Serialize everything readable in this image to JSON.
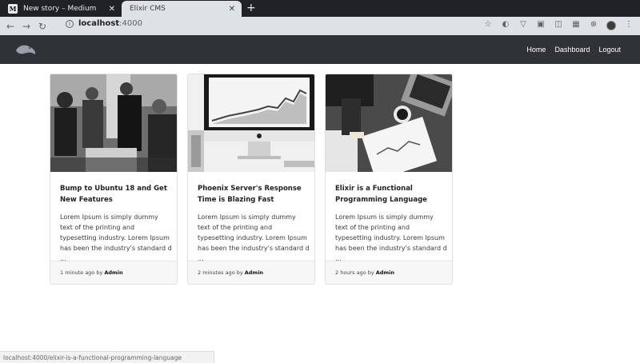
{
  "browser": {
    "tabs": [
      {
        "favicon": "M",
        "title": "New story – Medium",
        "active": false
      },
      {
        "title": "Elixir CMS",
        "active": true
      }
    ],
    "new_tab": "+",
    "address": {
      "host": "localhost",
      "port": ":4000"
    },
    "status_url": "localhost:4000/elixir-is-a-functional-programming-language"
  },
  "navbar": {
    "links": [
      "Home",
      "Dashboard",
      "Logout"
    ]
  },
  "posts": [
    {
      "title": "Bump to Ubuntu 18 and Get New Features",
      "excerpt": "Lorem Ipsum is simply dummy text of the printing and typesetting industry. Lorem Ipsum has been the industry's standard d ...",
      "time": "1 minute ago",
      "by": "by",
      "author": "Admin",
      "image": "team-meeting-photo"
    },
    {
      "title": "Phoenix Server's Response Time is Blazing Fast",
      "excerpt": "Lorem Ipsum is simply dummy text of the printing and typesetting industry. Lorem Ipsum has been the industry's standard d ...",
      "time": "2 minutes ago",
      "by": "by",
      "author": "Admin",
      "image": "imac-chart-photo"
    },
    {
      "title": "Elixir is a Functional Programming Language",
      "excerpt": "Lorem Ipsum is simply dummy text of the printing and typesetting industry. Lorem Ipsum has been the industry's standard d ...",
      "time": "2 hours ago",
      "by": "by",
      "author": "Admin",
      "image": "desk-documents-photo"
    }
  ]
}
